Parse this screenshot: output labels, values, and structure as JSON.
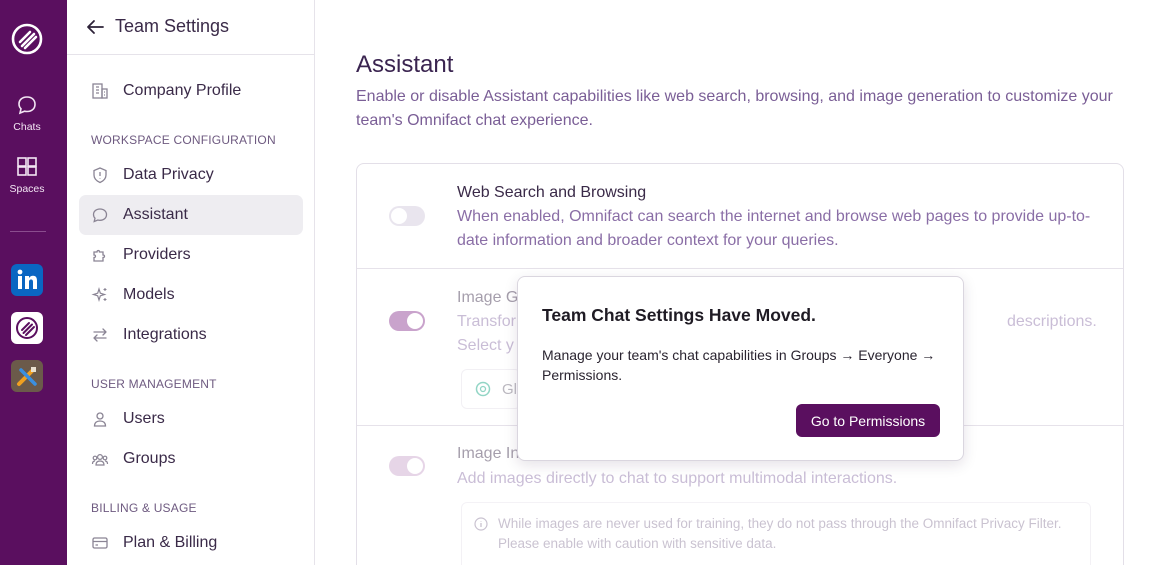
{
  "rail": {
    "items": [
      {
        "label": "Chats",
        "icon": "chat-bubble-icon"
      },
      {
        "label": "Spaces",
        "icon": "grid-icon"
      }
    ],
    "apps": [
      "linkedin-icon",
      "omnifact-app-icon",
      "tools-app-icon"
    ],
    "colors": {
      "rail_bg": "#5a0f5f",
      "linkedin": "#0a66c2"
    }
  },
  "sidebar": {
    "title": "Team Settings",
    "company_profile": "Company Profile",
    "sections": {
      "workspace": "WORKSPACE CONFIGURATION",
      "user_management": "USER MANAGEMENT",
      "billing": "BILLING & USAGE"
    },
    "items": {
      "data_privacy": "Data Privacy",
      "assistant": "Assistant",
      "providers": "Providers",
      "models": "Models",
      "integrations": "Integrations",
      "users": "Users",
      "groups": "Groups",
      "plan_billing": "Plan & Billing"
    },
    "active_item": "Assistant"
  },
  "main": {
    "title": "Assistant",
    "description": "Enable or disable Assistant capabilities like web search, browsing, and image generation to customize your team's Omnifact chat experience.",
    "options": [
      {
        "title": "Web Search and Browsing",
        "description": "When enabled, Omnifact can search the internet and browse web pages to provide up-to-date information and broader context for your queries.",
        "enabled": false
      },
      {
        "title": "Image G",
        "description_line1": "Transfor",
        "description_line1_end": "descriptions.",
        "description_line2": "Select y",
        "chip_text": "Gl",
        "enabled": true
      },
      {
        "title": "Image In",
        "description": "Add images directly to chat to support multimodal interactions.",
        "note": "While images are never used for training, they do not pass through the Omnifact Privacy Filter. Please enable with caution with sensitive data.",
        "enabled": true
      }
    ]
  },
  "popover": {
    "title": "Team Chat Settings Have Moved.",
    "body": "Manage your team's chat capabilities in Groups → Everyone → Permissions.",
    "button": "Go to Permissions"
  },
  "colors": {
    "accent": "#5a0f5f",
    "toggle_on": "#c9a3cc",
    "toggle_off": "#e9e5ee"
  }
}
